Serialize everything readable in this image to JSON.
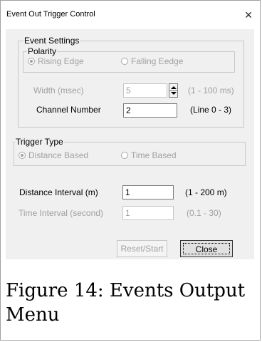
{
  "window": {
    "title": "Event Out Trigger Control",
    "close_glyph": "×"
  },
  "event_settings": {
    "legend": "Event Settings",
    "polarity": {
      "legend": "Polarity",
      "options": [
        {
          "label": "Rising Edge",
          "selected": true
        },
        {
          "label": "Falling Eedge",
          "selected": false
        }
      ]
    },
    "width": {
      "label": "Width (msec)",
      "value": "5",
      "range": "(1 - 100 ms)"
    },
    "channel": {
      "label": "Channel Number",
      "value": "2",
      "range": "(Line 0 - 3)"
    }
  },
  "trigger_type": {
    "legend": "Trigger Type",
    "options": [
      {
        "label": "Distance Based",
        "selected": true
      },
      {
        "label": "Time Based",
        "selected": false
      }
    ]
  },
  "distance_interval": {
    "label": "Distance Interval  (m)",
    "value": "1",
    "range": "(1 - 200 m)"
  },
  "time_interval": {
    "label": "Time Interval (second)",
    "value": "1",
    "range": "(0.1 -  30)"
  },
  "buttons": {
    "reset_start": "Reset/Start",
    "close": "Close"
  },
  "caption": "Figure 14:  Events Output Menu"
}
